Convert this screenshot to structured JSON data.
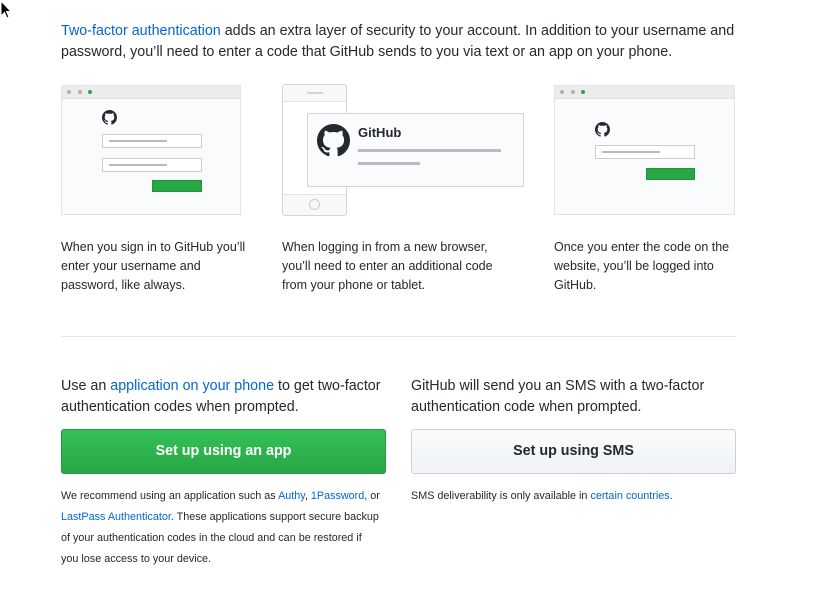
{
  "intro": {
    "link_text": "Two-factor authentication",
    "text": " adds an extra layer of security to your account. In addition to your username and password, you’ll need to enter a code that GitHub sends to you via text or an app on your phone."
  },
  "illustrations": {
    "middle_brand": "GitHub"
  },
  "steps": [
    {
      "text": "When you sign in to GitHub you’ll enter your username and password, like always."
    },
    {
      "text": "When logging in from a new browser, you’ll need to enter an additional code from your phone or tablet."
    },
    {
      "text": "Once you enter the code on the website, you’ll be logged into GitHub."
    }
  ],
  "app": {
    "text_prefix": "Use an ",
    "link_text": "application on your phone",
    "text_suffix": " to get two-factor authentication codes when prompted.",
    "button_label": "Set up using an app",
    "note_1": "We recommend using an application such as ",
    "link_authy": "Authy",
    "sep_1": ", ",
    "link_1password": "1Password",
    "sep_2": ", or ",
    "link_lastpass": "LastPass Authenticator",
    "note_2": ". These applications support secure backup of your authentication codes in the cloud and can be restored if you lose access to your device."
  },
  "sms": {
    "text": "GitHub will send you an SMS with a two-factor authentication code when prompted.",
    "button_label": "Set up using SMS",
    "note_prefix": "SMS deliverability is only available in ",
    "link_text": "certain countries",
    "note_suffix": "."
  },
  "icons": [
    "mouse-cursor-icon",
    "github-octocat-icon"
  ],
  "colors": {
    "link": "#0366d6",
    "primary_button": "#28a745",
    "text": "#24292e"
  }
}
